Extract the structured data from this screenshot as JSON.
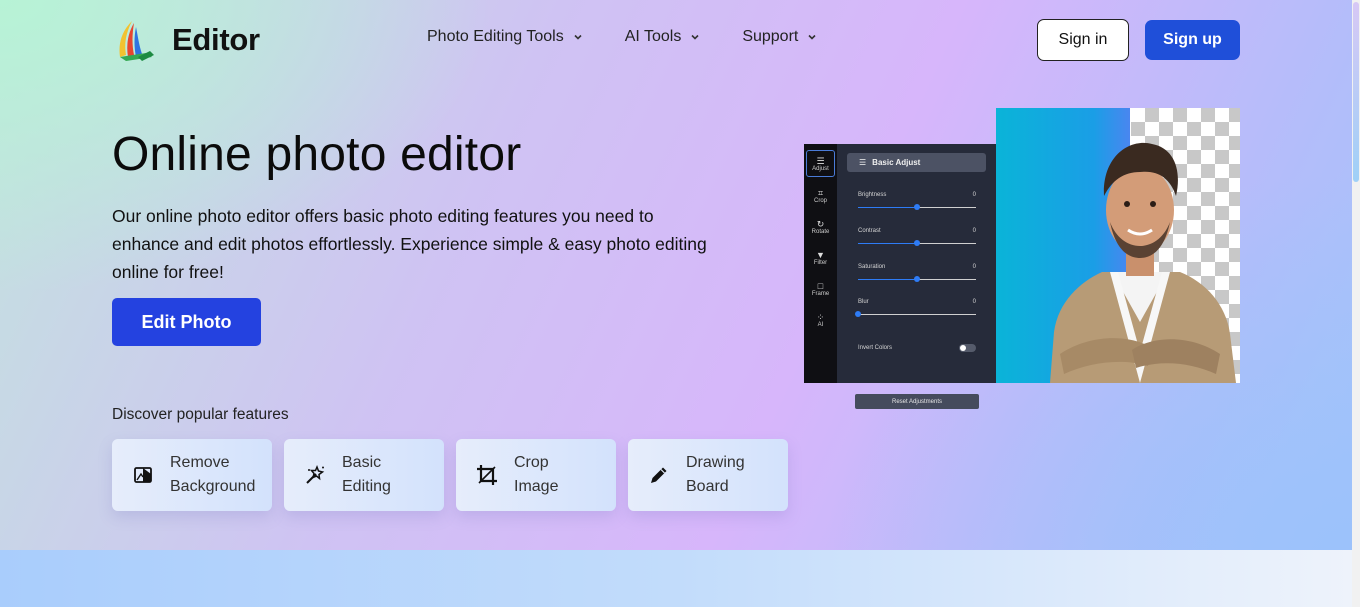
{
  "header": {
    "logo_text": "Editor",
    "nav": [
      {
        "label": "Photo Editing Tools"
      },
      {
        "label": "AI Tools"
      },
      {
        "label": "Support"
      }
    ],
    "signin_label": "Sign in",
    "signup_label": "Sign up"
  },
  "hero": {
    "title": "Online photo editor",
    "description": "Our online photo editor offers basic photo editing features you need to enhance and edit photos effortlessly. Experience simple & easy photo editing online for free!",
    "cta_label": "Edit Photo",
    "discover_label": "Discover popular features"
  },
  "features": [
    {
      "label": "Remove\nBackground",
      "icon": "remove-background-icon"
    },
    {
      "label": "Basic\nEditing",
      "icon": "magic-wand-icon"
    },
    {
      "label": "Crop\nImage",
      "icon": "crop-icon"
    },
    {
      "label": "Drawing\nBoard",
      "icon": "pencil-icon"
    }
  ],
  "mock_editor": {
    "tools": [
      {
        "label": "Adjust",
        "icon": "sliders-icon",
        "glyph": "☰"
      },
      {
        "label": "Crop",
        "icon": "crop-icon",
        "glyph": "⌗"
      },
      {
        "label": "Rotate",
        "icon": "rotate-icon",
        "glyph": "↻"
      },
      {
        "label": "Filter",
        "icon": "filter-icon",
        "glyph": "▼"
      },
      {
        "label": "Frame",
        "icon": "frame-icon",
        "glyph": "□"
      },
      {
        "label": "AI",
        "icon": "ai-icon",
        "glyph": "⁘"
      }
    ],
    "panel_title": "Basic Adjust",
    "sliders": [
      {
        "label": "Brightness",
        "value": "0",
        "position": 0.5
      },
      {
        "label": "Contrast",
        "value": "0",
        "position": 0.5
      },
      {
        "label": "Saturation",
        "value": "0",
        "position": 0.5
      },
      {
        "label": "Blur",
        "value": "0",
        "position": 0.0
      }
    ],
    "invert_label": "Invert Colors",
    "reset_label": "Reset Adjustments"
  },
  "colors": {
    "primary": "#1f4fd9",
    "cta": "#2442e0",
    "slider_accent": "#2e7cf6"
  }
}
